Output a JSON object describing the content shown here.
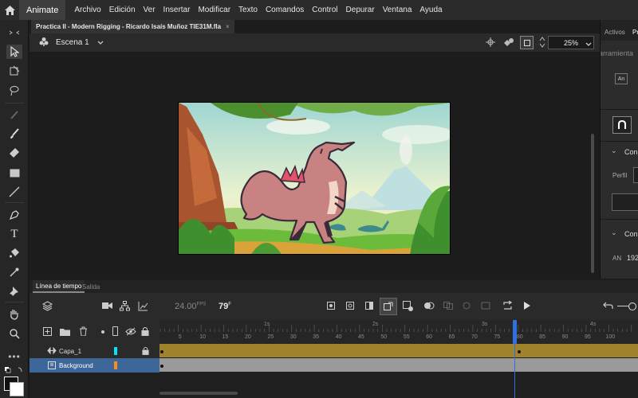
{
  "app": {
    "name": "Animate"
  },
  "menu": [
    "Archivo",
    "Edición",
    "Ver",
    "Insertar",
    "Modificar",
    "Texto",
    "Comandos",
    "Control",
    "Depurar",
    "Ventana",
    "Ayuda"
  ],
  "document": {
    "tab_title": "Practica II - Modern Rigging - Ricardo Isaís Muñoz TIE31M.fla",
    "close": "×"
  },
  "stage": {
    "scene": "Escena 1",
    "zoom": "25%"
  },
  "right_panel": {
    "tab_active": "Activos",
    "tab_partial": "Pr",
    "tools_partial": "arramienta",
    "section1": "Con",
    "perfil_label": "Perfil",
    "section2": "Con",
    "an_label": "AN",
    "an_value": "192"
  },
  "timeline": {
    "tabs": [
      "Línea de tiempo",
      "Salida"
    ],
    "fps": "24.00",
    "fps_unit": "FPS",
    "current_frame": "79",
    "frame_unit": "F",
    "ticks": [
      "5",
      "10",
      "15",
      "20",
      "25",
      "30",
      "35",
      "40",
      "45",
      "50",
      "55",
      "60",
      "65",
      "70",
      "75",
      "80",
      "85",
      "90",
      "95",
      "100"
    ],
    "seconds": [
      "1s",
      "2s",
      "3s",
      "4s"
    ],
    "layers": [
      {
        "name": "Capa_1",
        "color": "#00e5ff"
      },
      {
        "name": "Background",
        "color": "#ff8a1e"
      }
    ]
  },
  "colors": {
    "accent": "#2f6fe0",
    "layer1_frames": "#a1832d",
    "layer2_frames": "#9a9a9a",
    "selected_layer": "#3d6799"
  },
  "icons": [
    "home-icon",
    "selection-tool-icon",
    "free-transform-icon",
    "lasso-icon",
    "brush-icon",
    "eraser-icon",
    "rectangle-icon",
    "line-icon",
    "pen-icon",
    "text-icon",
    "paint-bucket-icon",
    "eyedropper-icon",
    "pin-icon",
    "hand-icon",
    "zoom-icon",
    "camera-icon",
    "play-icon"
  ]
}
